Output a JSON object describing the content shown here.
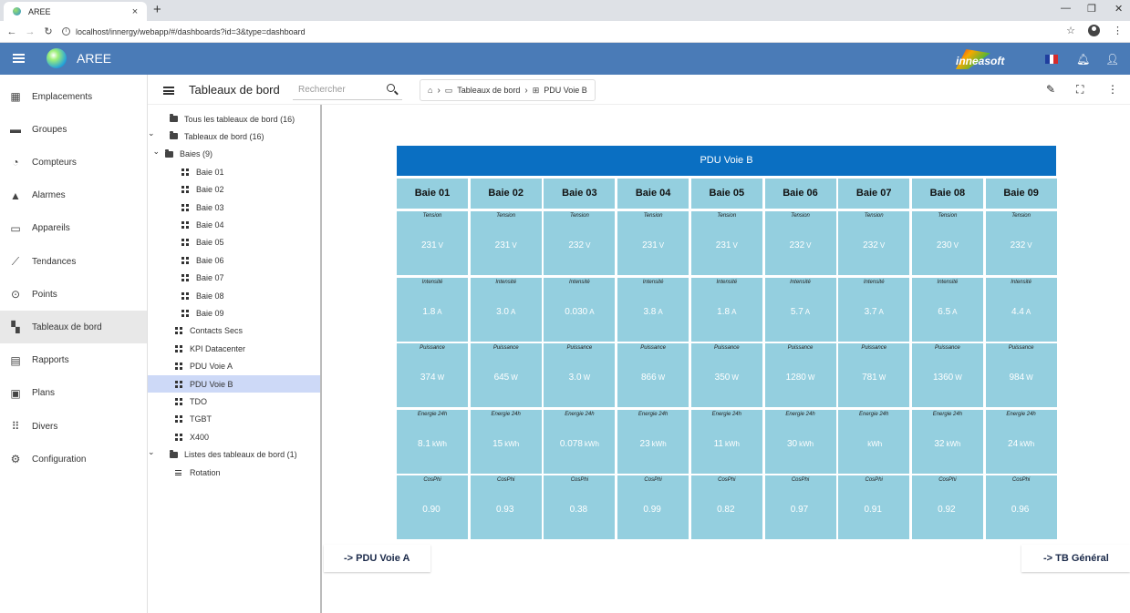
{
  "browser": {
    "tab_title": "AREE",
    "tab_close": "×",
    "new_tab": "+",
    "url": "localhost/innergy/webapp/#/dashboards?id=3&type=dashboard",
    "win_min": "—",
    "win_restore": "❐",
    "win_close": "✕"
  },
  "app": {
    "name": "AREE",
    "brand": "inneasoft",
    "flag_colors": [
      "#1f3e9e",
      "#ffffff",
      "#d52b2b"
    ],
    "header_color": "#4a7bb7"
  },
  "sidebar": {
    "items": [
      {
        "label": "Emplacements",
        "icon": "building-icon",
        "glyph": "▦"
      },
      {
        "label": "Groupes",
        "icon": "folder-icon",
        "glyph": "▬"
      },
      {
        "label": "Compteurs",
        "icon": "meter-icon",
        "glyph": "◔"
      },
      {
        "label": "Alarmes",
        "icon": "bell-icon",
        "glyph": "▲"
      },
      {
        "label": "Appareils",
        "icon": "devices-icon",
        "glyph": "▭"
      },
      {
        "label": "Tendances",
        "icon": "trend-icon",
        "glyph": "⟋"
      },
      {
        "label": "Points",
        "icon": "points-icon",
        "glyph": "⊙"
      },
      {
        "label": "Tableaux de bord",
        "icon": "dashboard-icon",
        "glyph": "▚"
      },
      {
        "label": "Rapports",
        "icon": "report-icon",
        "glyph": "▤"
      },
      {
        "label": "Plans",
        "icon": "plan-icon",
        "glyph": "▣"
      },
      {
        "label": "Divers",
        "icon": "apps-icon",
        "glyph": "⠿"
      },
      {
        "label": "Configuration",
        "icon": "gear-icon",
        "glyph": "⚙"
      }
    ],
    "active_index": 7
  },
  "pane": {
    "title": "Tableaux de bord",
    "search_placeholder": "Rechercher",
    "breadcrumb": [
      "Tableaux de bord",
      "PDU Voie B"
    ]
  },
  "tree": [
    {
      "label": "Tous les tableaux de bord (16)",
      "type": "folder",
      "level": 0,
      "chevron": ""
    },
    {
      "label": "Tableaux de bord (16)",
      "type": "folder",
      "level": 0,
      "chevron": "v"
    },
    {
      "label": "Baies (9)",
      "type": "folder",
      "level": 1,
      "chevron": "v"
    },
    {
      "label": "Baie 01",
      "type": "dashboard",
      "level": 2
    },
    {
      "label": "Baie 02",
      "type": "dashboard",
      "level": 2
    },
    {
      "label": "Baie 03",
      "type": "dashboard",
      "level": 2
    },
    {
      "label": "Baie 04",
      "type": "dashboard",
      "level": 2
    },
    {
      "label": "Baie 05",
      "type": "dashboard",
      "level": 2
    },
    {
      "label": "Baie 06",
      "type": "dashboard",
      "level": 2
    },
    {
      "label": "Baie 07",
      "type": "dashboard",
      "level": 2
    },
    {
      "label": "Baie 08",
      "type": "dashboard",
      "level": 2
    },
    {
      "label": "Baie 09",
      "type": "dashboard",
      "level": 2
    },
    {
      "label": "Contacts Secs",
      "type": "dashboard",
      "level": 1
    },
    {
      "label": "KPI Datacenter",
      "type": "dashboard",
      "level": 1
    },
    {
      "label": "PDU Voie A",
      "type": "dashboard",
      "level": 1
    },
    {
      "label": "PDU Voie B",
      "type": "dashboard",
      "level": 1,
      "selected": true
    },
    {
      "label": "TDO",
      "type": "dashboard",
      "level": 1
    },
    {
      "label": "TGBT",
      "type": "dashboard",
      "level": 1
    },
    {
      "label": "X400",
      "type": "dashboard",
      "level": 1
    },
    {
      "label": "Listes des tableaux de bord (1)",
      "type": "folder",
      "level": 0,
      "chevron": "v"
    },
    {
      "label": "Rotation",
      "type": "list",
      "level": 1
    }
  ],
  "dashboard": {
    "title": "PDU Voie B",
    "columns": [
      "Baie 01",
      "Baie 02",
      "Baie 03",
      "Baie 04",
      "Baie 05",
      "Baie 06",
      "Baie 07",
      "Baie 08",
      "Baie 09"
    ],
    "rows": [
      {
        "label": "Tension",
        "values": [
          [
            "231",
            "V"
          ],
          [
            "231",
            "V"
          ],
          [
            "232",
            "V"
          ],
          [
            "231",
            "V"
          ],
          [
            "231",
            "V"
          ],
          [
            "232",
            "V"
          ],
          [
            "232",
            "V"
          ],
          [
            "230",
            "V"
          ],
          [
            "232",
            "V"
          ]
        ]
      },
      {
        "label": "Intensité",
        "values": [
          [
            "1.8",
            "A"
          ],
          [
            "3.0",
            "A"
          ],
          [
            "0.030",
            "A"
          ],
          [
            "3.8",
            "A"
          ],
          [
            "1.8",
            "A"
          ],
          [
            "5.7",
            "A"
          ],
          [
            "3.7",
            "A"
          ],
          [
            "6.5",
            "A"
          ],
          [
            "4.4",
            "A"
          ]
        ]
      },
      {
        "label": "Puissance",
        "values": [
          [
            "374",
            "W"
          ],
          [
            "645",
            "W"
          ],
          [
            "3.0",
            "W"
          ],
          [
            "866",
            "W"
          ],
          [
            "350",
            "W"
          ],
          [
            "1280",
            "W"
          ],
          [
            "781",
            "W"
          ],
          [
            "1360",
            "W"
          ],
          [
            "984",
            "W"
          ]
        ]
      },
      {
        "label": "Energie 24h",
        "values": [
          [
            "8.1",
            "kWh"
          ],
          [
            "15",
            "kWh"
          ],
          [
            "0.078",
            "kWh"
          ],
          [
            "23",
            "kWh"
          ],
          [
            "11",
            "kWh"
          ],
          [
            "30",
            "kWh"
          ],
          [
            "",
            "kWh"
          ],
          [
            "32",
            "kWh"
          ],
          [
            "24",
            "kWh"
          ]
        ]
      },
      {
        "label": "CosPhi",
        "values": [
          [
            "0.90",
            ""
          ],
          [
            "0.93",
            ""
          ],
          [
            "0.38",
            ""
          ],
          [
            "0.99",
            ""
          ],
          [
            "0.82",
            ""
          ],
          [
            "0.97",
            ""
          ],
          [
            "0.91",
            ""
          ],
          [
            "0.92",
            ""
          ],
          [
            "0.96",
            ""
          ]
        ]
      }
    ],
    "link_left": "-> PDU Voie A",
    "link_right": "-> TB Général",
    "title_color": "#0a6fc2",
    "cell_color": "#94cfdf"
  }
}
